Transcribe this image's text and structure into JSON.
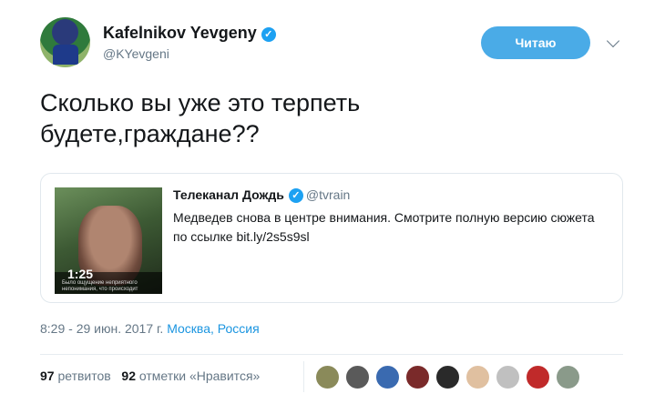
{
  "author": {
    "name": "Kafelnikov Yevgeny",
    "handle": "@KYevgeni",
    "verified_icon": "✓"
  },
  "follow_button_label": "Читаю",
  "tweet_text": "Сколько вы уже это терпеть\nбудете,граждане??",
  "quote": {
    "name": "Телеканал Дождь",
    "handle": "@tvrain",
    "verified_icon": "✓",
    "text": "Медведев снова в центре внимания. Смотрите полную версию сюжета по ссылке bit.ly/2s5s9sl",
    "video_duration": "1:25",
    "video_subtitle": "Было ощущение неприятного непонимания, что происходит"
  },
  "timestamp": {
    "time_date": "8:29 - 29 июн. 2017 г.",
    "location": "Москва, Россия"
  },
  "stats": {
    "retweets_count": "97",
    "retweets_label": "ретвитов",
    "likes_count": "92",
    "likes_label": "отметки «Нравится»"
  },
  "liker_avatar_colors": [
    "#8a8a5a",
    "#5a5a5a",
    "#3a6ab0",
    "#7a2a2a",
    "#2a2a2a",
    "#e0c0a0",
    "#c0c0c0",
    "#c02a2a",
    "#8a9a8a"
  ],
  "colors": {
    "accent": "#1da1f2",
    "follow_button": "#4aabe7",
    "link": "#1b95e0",
    "muted_text": "#657786"
  }
}
